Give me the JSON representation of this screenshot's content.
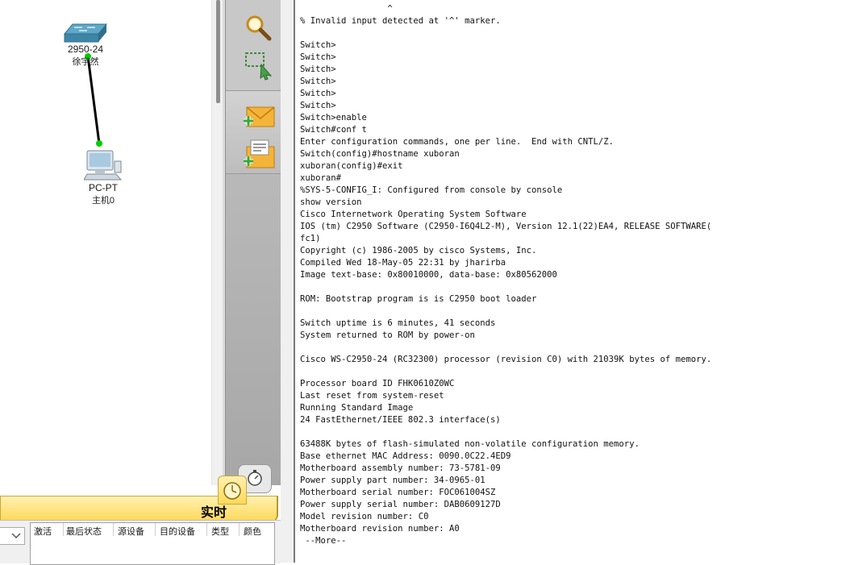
{
  "topology": {
    "devices": [
      {
        "model": "2950-24",
        "name": "徐宇然",
        "icon": "switch-icon"
      },
      {
        "model": "PC-PT",
        "name": "主机0",
        "icon": "pc-icon"
      }
    ],
    "link": {
      "from": "2950-24",
      "to": "PC-PT",
      "status_color": "#00cc00"
    }
  },
  "tools": {
    "items": [
      "inspect-magnifier-icon",
      "select-region-icon",
      "add-simple-pdu-icon",
      "add-complex-pdu-icon"
    ]
  },
  "bottom_panel": {
    "mode_label": "实时",
    "columns": [
      "激活",
      "最后状态",
      "源设备",
      "目的设备",
      "类型",
      "颜色"
    ]
  },
  "terminal": {
    "caret_line": "                 ^",
    "lines": [
      "% Invalid input detected at '^' marker.",
      "",
      "Switch>",
      "Switch>",
      "Switch>",
      "Switch>",
      "Switch>",
      "Switch>",
      "Switch>enable",
      "Switch#conf t",
      "Enter configuration commands, one per line.  End with CNTL/Z.",
      "Switch(config)#hostname xuboran",
      "xuboran(config)#exit",
      "xuboran#",
      "%SYS-5-CONFIG_I: Configured from console by console",
      "show version",
      "Cisco Internetwork Operating System Software",
      "IOS (tm) C2950 Software (C2950-I6Q4L2-M), Version 12.1(22)EA4, RELEASE SOFTWARE(",
      "fc1)",
      "Copyright (c) 1986-2005 by cisco Systems, Inc.",
      "Compiled Wed 18-May-05 22:31 by jharirba",
      "Image text-base: 0x80010000, data-base: 0x80562000",
      "",
      "ROM: Bootstrap program is is C2950 boot loader",
      "",
      "Switch uptime is 6 minutes, 41 seconds",
      "System returned to ROM by power-on",
      "",
      "Cisco WS-C2950-24 (RC32300) processor (revision C0) with 21039K bytes of memory.",
      "",
      "Processor board ID FHK0610Z0WC",
      "Last reset from system-reset",
      "Running Standard Image",
      "24 FastEthernet/IEEE 802.3 interface(s)",
      "",
      "63488K bytes of flash-simulated non-volatile configuration memory.",
      "Base ethernet MAC Address: 0090.0C22.4ED9",
      "Motherboard assembly number: 73-5781-09",
      "Power supply part number: 34-0965-01",
      "Motherboard serial number: FOC061004SZ",
      "Power supply serial number: DAB0609127D",
      "Model revision number: C0",
      "Motherboard revision number: A0",
      " --More--"
    ]
  }
}
